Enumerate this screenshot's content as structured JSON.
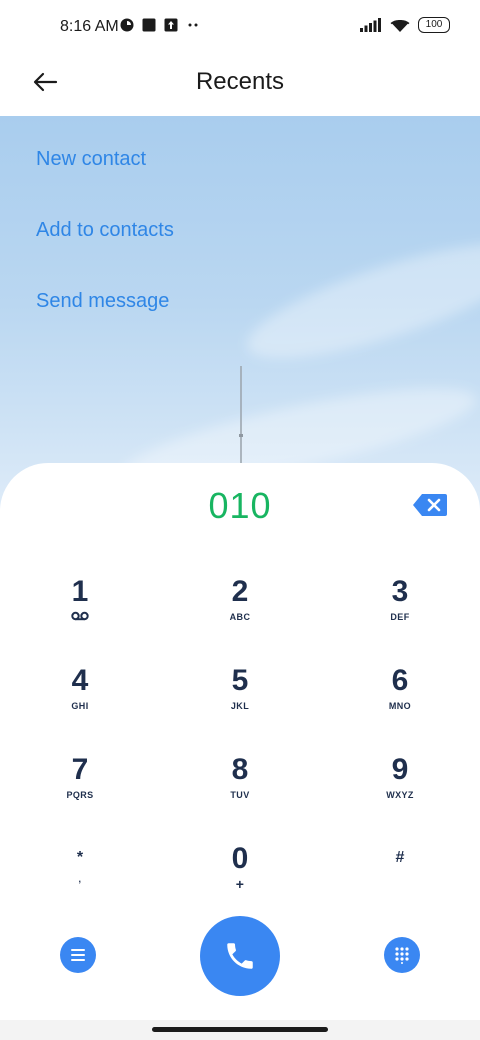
{
  "status_bar": {
    "time": "8:16 AM",
    "battery": "100",
    "icons_left": [
      "app-notification-icon",
      "square-icon",
      "upload-icon",
      "more-dots-icon"
    ],
    "icons_right": [
      "signal-icon",
      "wifi-icon",
      "battery-icon"
    ]
  },
  "header": {
    "title": "Recents",
    "back_icon": "back-arrow-icon"
  },
  "actions": [
    {
      "label": "New contact"
    },
    {
      "label": "Add to contacts"
    },
    {
      "label": "Send message"
    }
  ],
  "dialer": {
    "number": "010",
    "backspace_icon": "backspace-icon",
    "keys": [
      {
        "digit": "1",
        "letters": "",
        "sub_icon": "voicemail-icon"
      },
      {
        "digit": "2",
        "letters": "ABC"
      },
      {
        "digit": "3",
        "letters": "DEF"
      },
      {
        "digit": "4",
        "letters": "GHI"
      },
      {
        "digit": "5",
        "letters": "JKL"
      },
      {
        "digit": "6",
        "letters": "MNO"
      },
      {
        "digit": "7",
        "letters": "PQRS"
      },
      {
        "digit": "8",
        "letters": "TUV"
      },
      {
        "digit": "9",
        "letters": "WXYZ"
      },
      {
        "digit": "*",
        "letters": ","
      },
      {
        "digit": "0",
        "letters": "+"
      },
      {
        "digit": "#",
        "letters": ""
      }
    ],
    "bottom": {
      "menu_icon": "menu-icon",
      "call_icon": "phone-icon",
      "keypad_icon": "dialpad-icon"
    }
  },
  "colors": {
    "accent": "#3a87f2",
    "link": "#2f86e6",
    "number": "#18b561",
    "key_text": "#1f2f4d"
  }
}
